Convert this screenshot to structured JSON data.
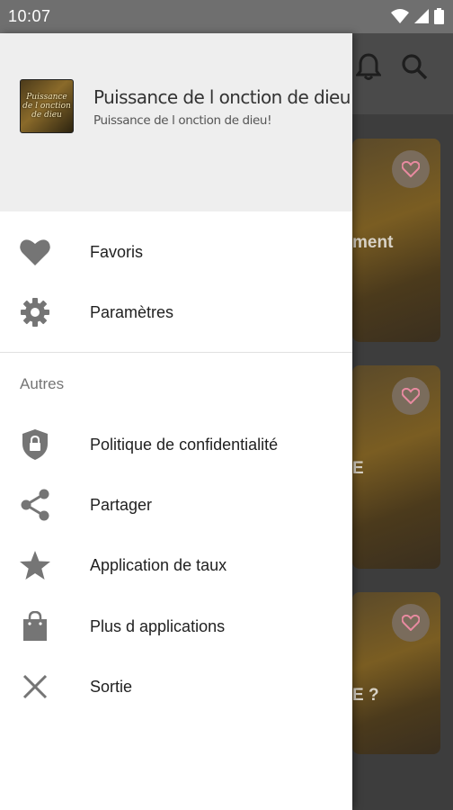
{
  "status_bar": {
    "time": "10:07",
    "icons": [
      "wifi-icon",
      "signal-icon",
      "battery-icon"
    ]
  },
  "background_app": {
    "toolbar_icons": [
      "bell-icon",
      "search-icon"
    ],
    "card_fragments": [
      "ment",
      "E",
      "E ?"
    ]
  },
  "drawer": {
    "header": {
      "logo_text": [
        "Puissance",
        "de l onction",
        "de dieu"
      ],
      "title": "Puissance de l onction de dieu",
      "subtitle": "Puissance de l onction de dieu!"
    },
    "items": [
      {
        "label": "Favoris",
        "icon": "heart-icon"
      },
      {
        "label": "Paramètres",
        "icon": "gear-icon"
      }
    ],
    "section_title": "Autres",
    "other_items": [
      {
        "label": "Politique de confidentialité",
        "icon": "shield-lock-icon"
      },
      {
        "label": "Partager",
        "icon": "share-icon"
      },
      {
        "label": "Application de taux",
        "icon": "star-icon"
      },
      {
        "label": "Plus d applications",
        "icon": "shopping-bag-icon"
      },
      {
        "label": "Sortie",
        "icon": "close-icon"
      }
    ]
  },
  "colors": {
    "icon_gray": "#757575",
    "header_bg": "#eeeeee",
    "text_primary": "#212121"
  }
}
